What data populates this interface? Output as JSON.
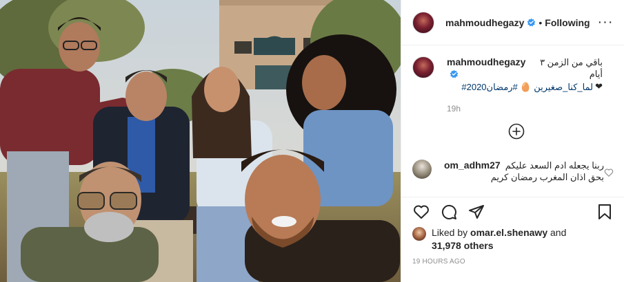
{
  "post": {
    "username": "mahmoudhegazy",
    "separator": "•",
    "follow_label": "Following",
    "more_label": "···"
  },
  "caption": {
    "username": "mahmoudhegazy",
    "text": "باقي من الزمن ٣ أيام",
    "hashtags": "لما_كنا_صغيرين 🥚 #رمضان2020#",
    "emoji": "❤",
    "time": "19h"
  },
  "comment": {
    "username": "om_adhm27",
    "text_line1": "ربنا يجعله ادم السعد عليكم",
    "text_line2": "بحق اذان المغرب رمضان كريم"
  },
  "likes": {
    "prefix": "Liked by",
    "liked_user": "omar.el.shenawy",
    "and": "and",
    "others": "31,978 others"
  },
  "timestamp": "19 HOURS AGO",
  "icons": {
    "verified": "verified-badge-icon",
    "more": "more-options-icon",
    "load_more": "plus-circle-icon",
    "like": "heart-icon",
    "comment": "comment-bubble-icon",
    "share": "paper-plane-icon",
    "save": "bookmark-icon"
  },
  "colors": {
    "verified_blue": "#3897f0",
    "link_blue": "#00376b",
    "text": "#262626",
    "muted": "#8e8e8e",
    "border": "#efefef"
  }
}
